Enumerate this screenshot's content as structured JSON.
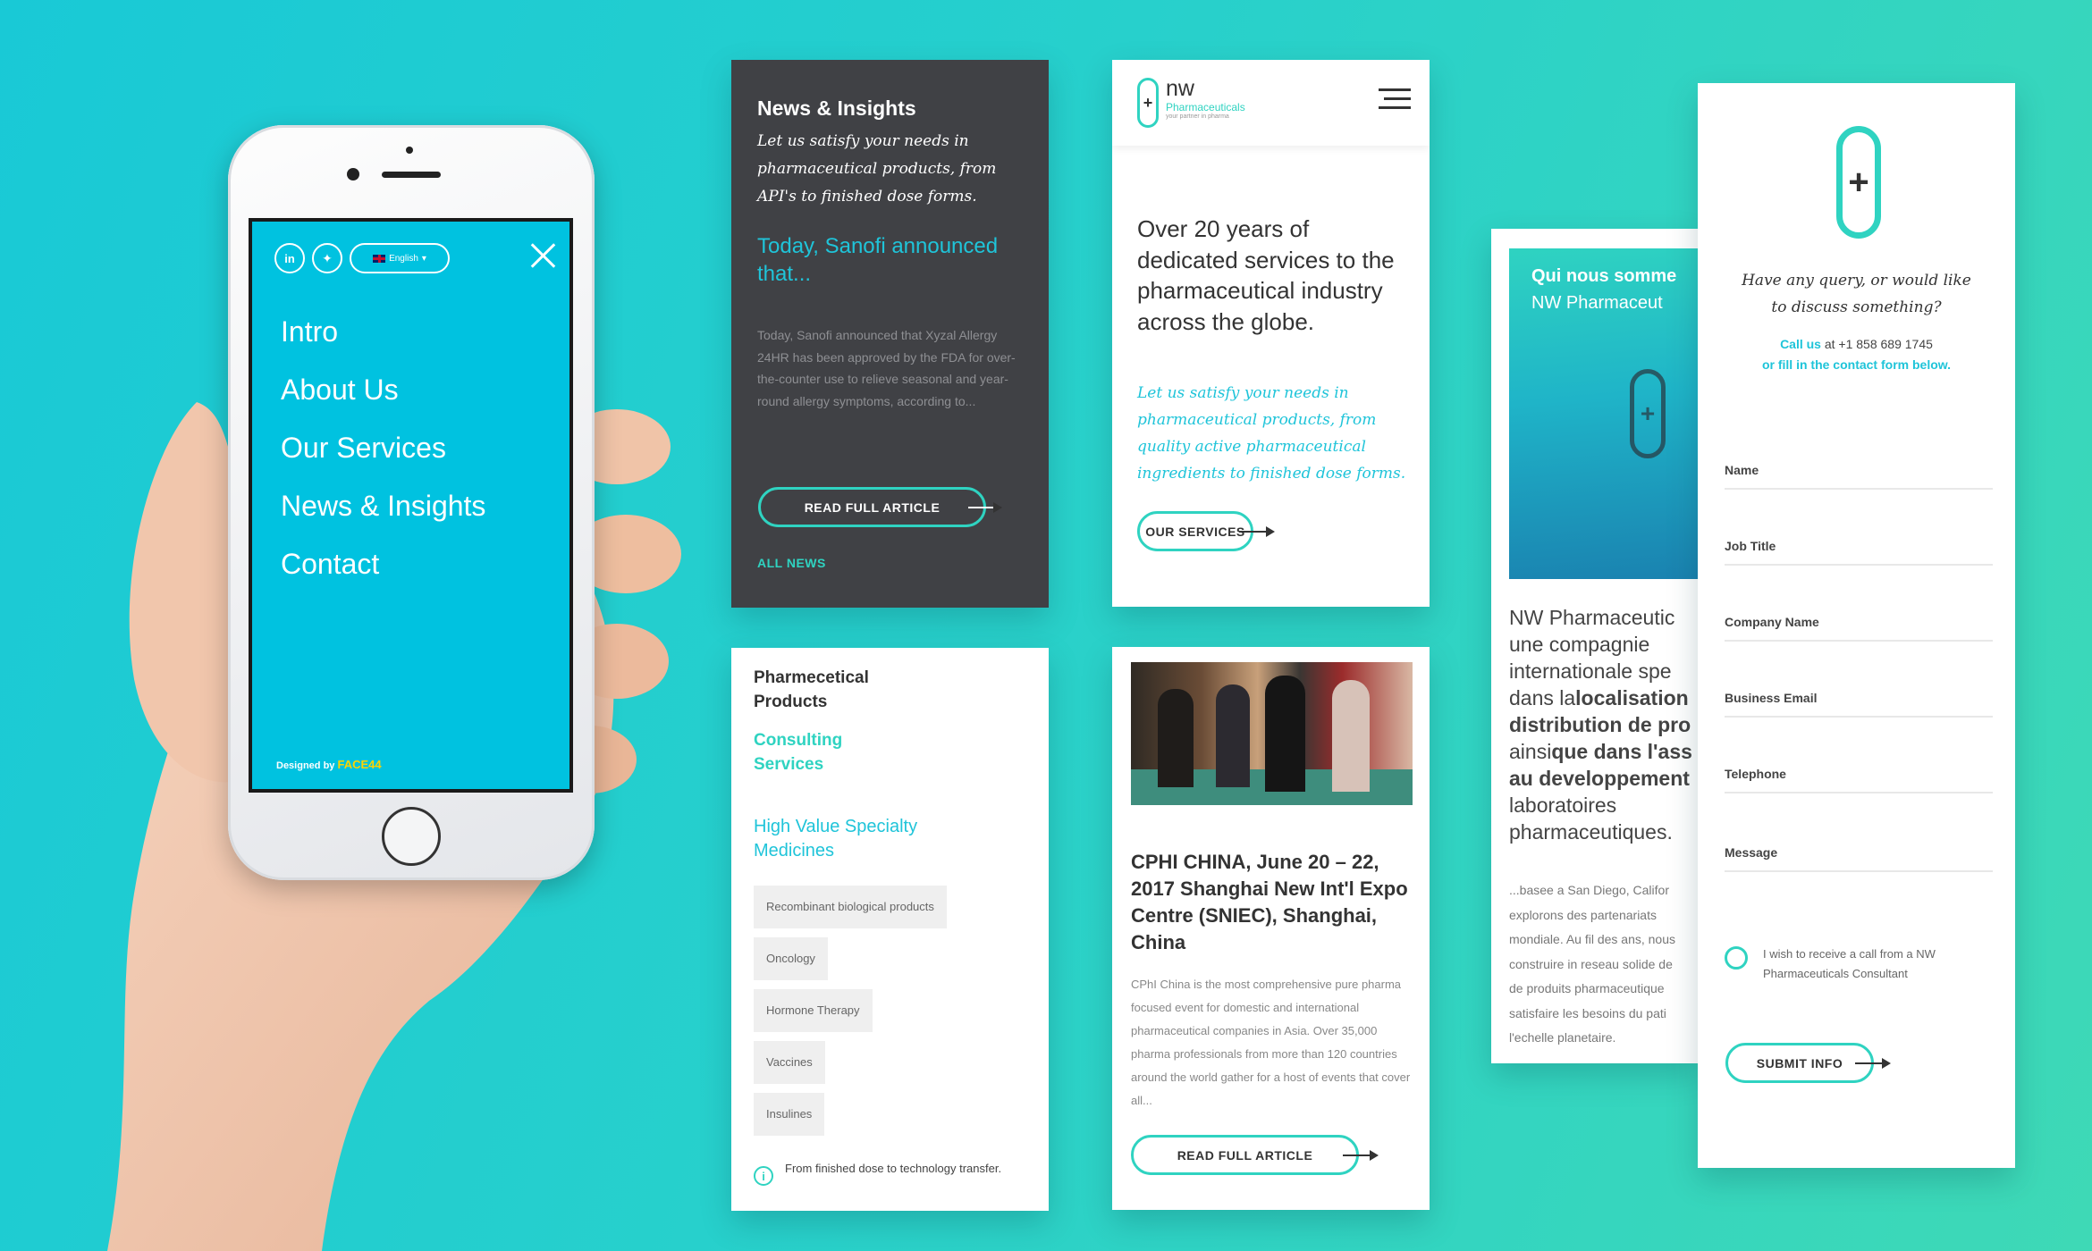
{
  "phone": {
    "lang": "English",
    "menu": [
      "Intro",
      "About Us",
      "Our Services",
      "News & Insights",
      "Contact"
    ],
    "designed_by_prefix": "Designed by",
    "designed_by_brand": "FACE44"
  },
  "news_card": {
    "heading": "News & Insights",
    "intro": "Let us satisfy your needs in pharmaceutical products, from API's to finished dose forms.",
    "headline": "Today, Sanofi announced that...",
    "body": "Today, Sanofi announced that Xyzal Allergy 24HR has been approved by the FDA for over-the-counter use to relieve seasonal and year-round allergy symptoms, according to...",
    "button": "READ FULL ARTICLE",
    "all_news": "ALL NEWS"
  },
  "home_card": {
    "logo_nw": "nw",
    "logo_pharma": "Pharmaceuticals",
    "logo_tagline": "your partner in pharma",
    "heading": "Over 20 years of dedicated services to the pharmaceutical industry across the globe.",
    "intro": "Let us satisfy your needs in pharmaceutical products, from quality active pharmaceutical ingredients to finished dose forms.",
    "button": "OUR SERVICES"
  },
  "products_card": {
    "active": "Pharmecetical Products",
    "consulting": "Consulting Services",
    "hvsm": "High Value Specialty Medicines",
    "tags": [
      "Recombinant biological products",
      "Oncology",
      "Hormone Therapy",
      "Vaccines",
      "Insulines"
    ],
    "note": "From finished dose to technology transfer."
  },
  "event_card": {
    "title": "CPHI CHINA, June 20 – 22, 2017 Shanghai New Int'l Expo Centre (SNIEC), Shanghai, China",
    "body": "CPhI China is the most comprehensive pure pharma focused event for domestic and international pharmaceutical companies in Asia. Over 35,000 pharma professionals from more than 120 countries around the world gather for a host of events that cover all...",
    "button": "READ FULL ARTICLE"
  },
  "french_card": {
    "hero_line1": "Qui nous somme",
    "hero_line2": "NW Pharmaceut",
    "p1": "NW Pharmaceutic",
    "p2": "une compagnie",
    "p3": "internationale spe",
    "p4a": "dans la",
    "p4b": "localisation",
    "p5": "distribution de pro",
    "p6a": "ainsi",
    "p6b": "que dans l'ass",
    "p7": "au developpement",
    "p8": "laboratoires",
    "p9": "pharmaceutiques.",
    "s1": "...basee a San Diego, Califor",
    "s2": "explorons des partenariats",
    "s3": "mondiale. Au fil des ans, nous",
    "s4": "construire in reseau solide de",
    "s5": "de produits pharmaceutique",
    "s6": "satisfaire les besoins du pati",
    "s7": "l'echelle planetaire."
  },
  "contact_card": {
    "query": "Have any query, or would like to discuss something?",
    "call_link": "Call us",
    "call_rest": " at +1 858 689 1745",
    "form_link": "or fill in the contact form below.",
    "fields": [
      "Name",
      "Job Title",
      "Company Name",
      "Business Email",
      "Telephone",
      "Message"
    ],
    "consent": "I wish to receive a call from a NW Pharmaceuticals Consultant",
    "button": "SUBMIT INFO"
  },
  "colors": {
    "accent": "#00c2e0",
    "teal": "#2fd3c1",
    "dark": "#404145"
  }
}
